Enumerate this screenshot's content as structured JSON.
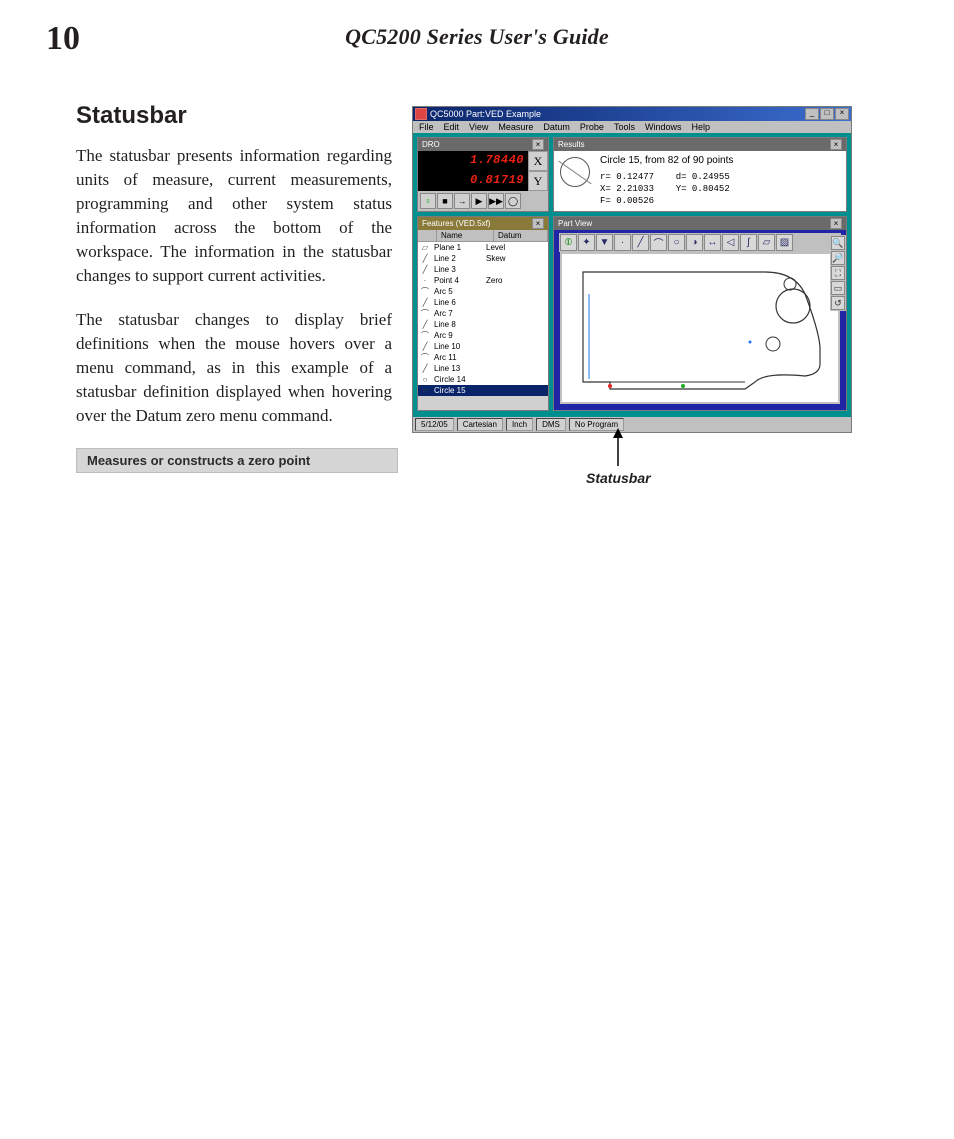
{
  "page_number": "10",
  "guide_title": "QC5200 Series User's Guide",
  "section_title": "Statusbar",
  "para1": "The statusbar presents information regarding units of measure, current measurements, programming and other system status information across the bottom of the workspace.  The information in the statusbar changes to support current activities.",
  "para2": "The statusbar changes to display brief definitions when the mouse hovers over a menu command, as in this example of a statusbar definition displayed when hovering over the Datum zero menu command.",
  "tooltip_text": "Measures or constructs a zero point",
  "annotation_label": "Statusbar",
  "app": {
    "title": "QC5000 Part:VED Example",
    "menu": [
      "File",
      "Edit",
      "View",
      "Measure",
      "Datum",
      "Probe",
      "Tools",
      "Windows",
      "Help"
    ],
    "dro_title": "DRO",
    "dro_x": "1.78440",
    "dro_y": "0.81719",
    "axis_x": "X",
    "axis_y": "Y",
    "results_title": "Results",
    "results_heading": "Circle 15, from 82 of 90 points",
    "r_label": "r=",
    "r_val": "0.12477",
    "d_label": "d=",
    "d_val": "0.24955",
    "x_label": "X=",
    "x_val": "2.21033",
    "y_label": "Y=",
    "y_val": "0.80452",
    "f_label": "F=",
    "f_val": "0.00526",
    "features_title": "Features (VED.5xf)",
    "feat_cols": {
      "c2": "Name",
      "c3": "Datum"
    },
    "features": [
      {
        "ic": "▱",
        "name": "Plane 1",
        "datum": "Level"
      },
      {
        "ic": "╱",
        "name": "Line 2",
        "datum": "Skew"
      },
      {
        "ic": "╱",
        "name": "Line 3",
        "datum": ""
      },
      {
        "ic": "·",
        "name": "Point 4",
        "datum": "Zero"
      },
      {
        "ic": "⌒",
        "name": "Arc 5",
        "datum": ""
      },
      {
        "ic": "╱",
        "name": "Line 6",
        "datum": ""
      },
      {
        "ic": "⌒",
        "name": "Arc 7",
        "datum": ""
      },
      {
        "ic": "╱",
        "name": "Line 8",
        "datum": ""
      },
      {
        "ic": "⌒",
        "name": "Arc 9",
        "datum": ""
      },
      {
        "ic": "╱",
        "name": "Line 10",
        "datum": ""
      },
      {
        "ic": "⌒",
        "name": "Arc 11",
        "datum": ""
      },
      {
        "ic": "╱",
        "name": "Line 13",
        "datum": ""
      },
      {
        "ic": "○",
        "name": "Circle 14",
        "datum": ""
      },
      {
        "ic": "○",
        "name": "Circle 15",
        "datum": "",
        "selected": true
      }
    ],
    "partview_title": "Part View",
    "status": {
      "date": "5/12/05",
      "coord": "Cartesian",
      "unit": "Inch",
      "ang": "DMS",
      "prog": "No Program"
    }
  }
}
